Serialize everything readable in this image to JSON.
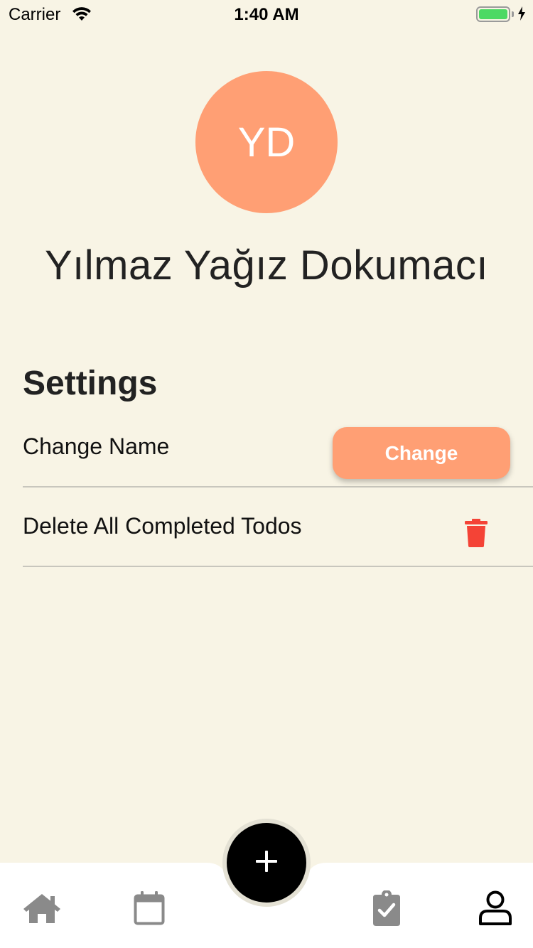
{
  "status_bar": {
    "carrier": "Carrier",
    "time": "1:40 AM",
    "battery_color": "#4cd964"
  },
  "profile": {
    "initials": "YD",
    "name": "Yılmaz Yağız Dokumacı",
    "avatar_color": "#ff9f74"
  },
  "settings": {
    "title": "Settings",
    "change_name_label": "Change Name",
    "change_button_label": "Change",
    "delete_label": "Delete All Completed Todos",
    "delete_icon": "trash-icon",
    "delete_icon_color": "#f44336"
  },
  "bottom_nav": {
    "items": [
      {
        "icon": "home-icon"
      },
      {
        "icon": "calendar-icon"
      },
      {
        "icon": "tasks-icon"
      },
      {
        "icon": "profile-icon",
        "active": true
      }
    ],
    "fab_icon": "plus-icon"
  },
  "colors": {
    "background": "#f8f4e5",
    "accent": "#ff9f74",
    "nav_inactive": "#8a8a8a",
    "nav_active": "#000000"
  }
}
